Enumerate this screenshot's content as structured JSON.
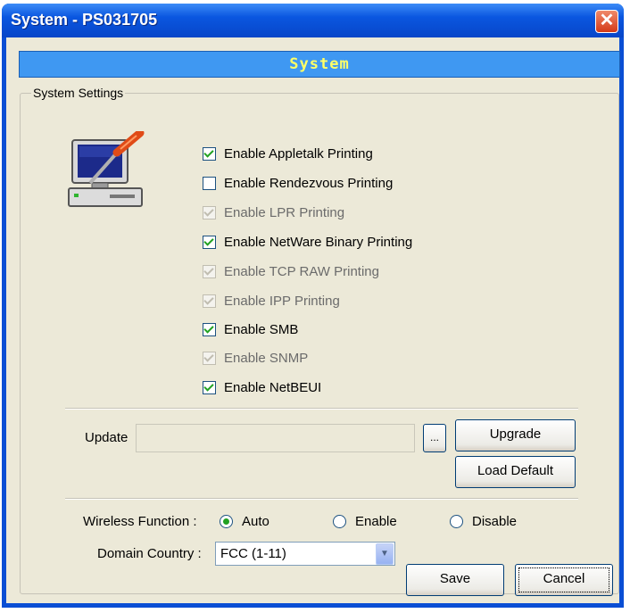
{
  "window": {
    "title": "System - PS031705",
    "close_glyph": "✕"
  },
  "banner": {
    "text": "System"
  },
  "group": {
    "legend": "System Settings"
  },
  "checkboxes": [
    {
      "label": "Enable Appletalk Printing",
      "checked": true,
      "disabled": false
    },
    {
      "label": "Enable Rendezvous Printing",
      "checked": false,
      "disabled": false
    },
    {
      "label": "Enable LPR Printing",
      "checked": true,
      "disabled": true
    },
    {
      "label": "Enable NetWare Binary Printing",
      "checked": true,
      "disabled": false
    },
    {
      "label": "Enable TCP RAW Printing",
      "checked": true,
      "disabled": true
    },
    {
      "label": "Enable IPP Printing",
      "checked": true,
      "disabled": true
    },
    {
      "label": "Enable SMB",
      "checked": true,
      "disabled": false
    },
    {
      "label": "Enable SNMP",
      "checked": true,
      "disabled": true
    },
    {
      "label": "Enable NetBEUI",
      "checked": true,
      "disabled": false
    }
  ],
  "update": {
    "label": "Update",
    "value": "",
    "browse_label": "...",
    "upgrade_label": "Upgrade",
    "load_default_label": "Load Default"
  },
  "wireless": {
    "label": "Wireless Function :",
    "options": [
      {
        "label": "Auto",
        "selected": true
      },
      {
        "label": "Enable",
        "selected": false
      },
      {
        "label": "Disable",
        "selected": false
      }
    ]
  },
  "domain": {
    "label": "Domain Country :",
    "value": "FCC (1-11)"
  },
  "footer": {
    "save_label": "Save",
    "cancel_label": "Cancel"
  },
  "icons": {
    "settings": "computer-screwdriver-icon",
    "dropdown": "chevron-down-icon"
  }
}
